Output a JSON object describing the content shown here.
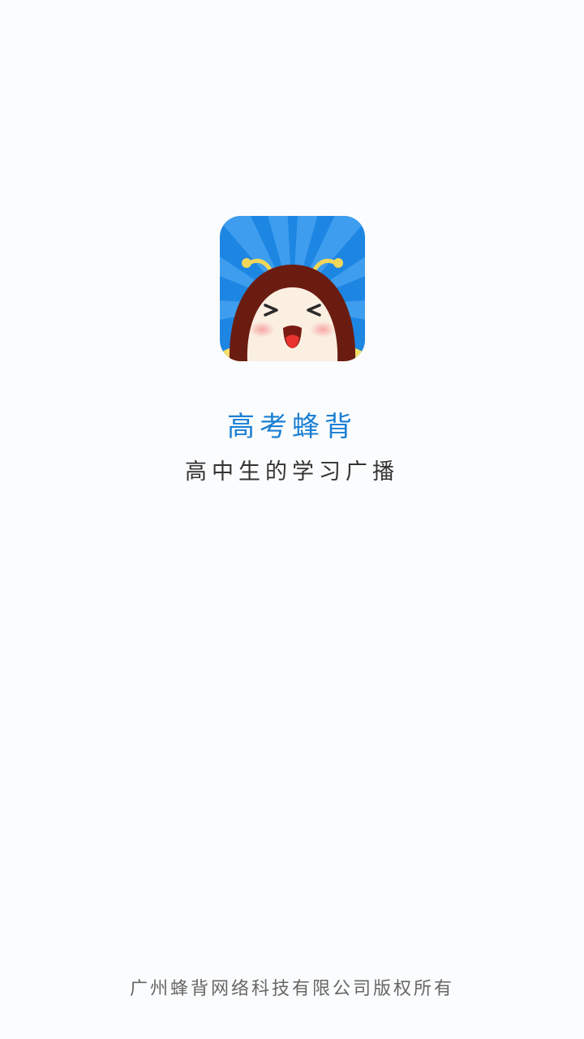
{
  "splash": {
    "logo_icon": "bee-mascot-icon",
    "app_name": "高考蜂背",
    "slogan": "高中生的学习广播",
    "copyright": "广州蜂背网络科技有限公司版权所有"
  },
  "colors": {
    "background": "#fbfcfd",
    "brand_blue": "#1a7fd4",
    "slogan_text": "#333333",
    "copyright_text": "#666666",
    "mascot_hair": "#6b1c10"
  }
}
